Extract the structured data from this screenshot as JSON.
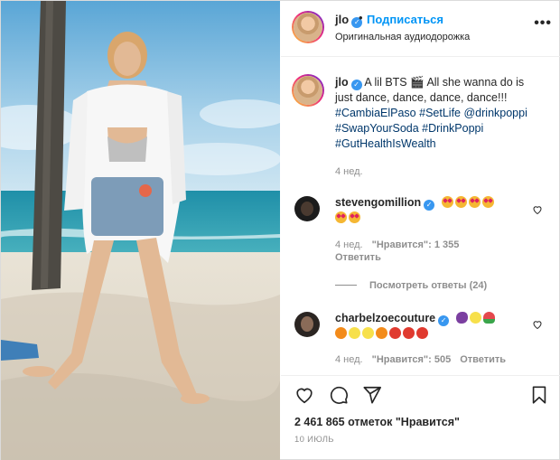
{
  "post": {
    "username": "jlo",
    "follow_label": "Подписаться",
    "dot": "•",
    "audio": "Оригинальная аудиодорожка",
    "more_label": "•••"
  },
  "caption": {
    "username": "jlo",
    "line1": "A lil BTS 🎬 All she wanna do is",
    "line2": "just dance, dance, dance, dance!!!",
    "tags1a": "#CambiaElPaso",
    "tags1b": "#SetLife",
    "tags1c": "@drinkpoppi",
    "tags2a": "#SwapYourSoda",
    "tags2b": "#DrinkPoppi",
    "tags3": "#GutHealthIsWealth",
    "time": "4 нед."
  },
  "comments": [
    {
      "username": "stevengomillion",
      "emojis_line1": [
        "star-eyes",
        "star-eyes",
        "star-eyes",
        "star-eyes"
      ],
      "emojis_line2": [
        "star-eyes",
        "star-eyes"
      ],
      "time": "4 нед.",
      "likes": "\"Нравится\": 1 355",
      "reply": "Ответить"
    },
    {
      "username": "charbelzoecouture",
      "emojis_line1": [
        "eggplant",
        "lemon",
        "watermelon"
      ],
      "emojis_line2": [
        "tangerine",
        "lemon",
        "lemon",
        "tangerine",
        "apple",
        "apple",
        "apple"
      ],
      "time": "4 нед.",
      "likes": "\"Нравится\": 505",
      "reply": "Ответить"
    }
  ],
  "view_replies": "Посмотреть ответы (24)",
  "footer": {
    "likes": "2 461 865 отметок \"Нравится\"",
    "date": "10 ИЮЛЬ"
  },
  "icons": {
    "like": "heart-icon",
    "comment": "comment-icon",
    "share": "share-icon",
    "save": "bookmark-icon",
    "comment_like": "heart-icon"
  },
  "colors": {
    "accent": "#0095f6",
    "hashtag": "#00376b",
    "muted": "#8e8e8e",
    "verified": "#3897f0"
  }
}
